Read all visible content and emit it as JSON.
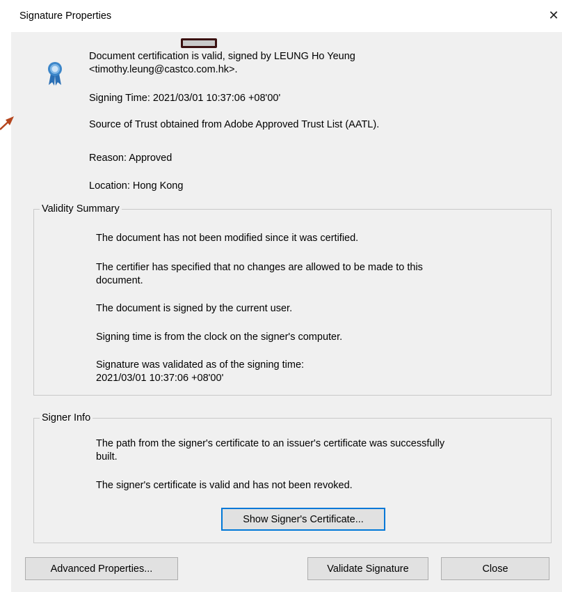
{
  "window": {
    "title": "Signature Properties",
    "close_label": "✕"
  },
  "header": {
    "icon": "certification-ribbon-icon",
    "status_line1": "Document certification is valid, signed by LEUNG Ho Yeung",
    "status_line2": "<timothy.leung@castco.com.hk>.",
    "signing_time": "Signing Time:  2021/03/01 10:37:06 +08'00'",
    "trust_source": "Source of Trust obtained from Adobe Approved Trust List (AATL).",
    "reason": "Reason:  Approved",
    "location": "Location:  Hong Kong"
  },
  "validity_summary": {
    "legend": "Validity Summary",
    "lines": [
      "The document has not been modified since it was certified.",
      "The certifier has specified that no changes are allowed to be made to this",
      "document.",
      "The document is signed by the current user.",
      "Signing time is from the clock on the signer's computer.",
      "Signature was validated as of the signing time:",
      "2021/03/01 10:37:06 +08'00'"
    ]
  },
  "signer_info": {
    "legend": "Signer Info",
    "lines": [
      "The path from the signer's certificate to an issuer's certificate was successfully",
      "built.",
      "The signer's certificate is valid and has not been revoked."
    ],
    "show_cert_button": "Show Signer's Certificate..."
  },
  "footer": {
    "advanced_button": "Advanced Properties...",
    "validate_button": "Validate Signature",
    "close_button": "Close"
  },
  "colors": {
    "dialog_bg": "#f0f0f0",
    "focus_border": "#0078d7",
    "annotation_arrow": "#b5461e"
  }
}
